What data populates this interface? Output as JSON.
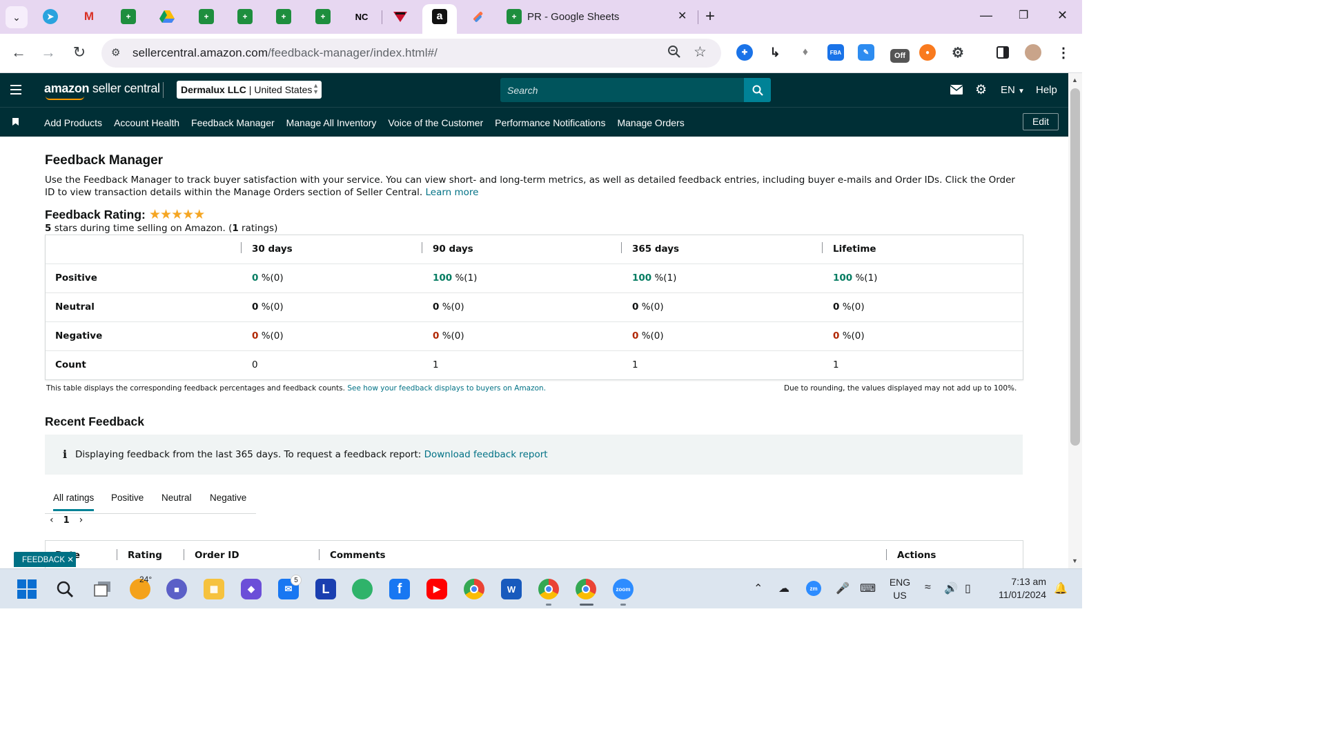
{
  "browser": {
    "active_tab_title": "PR - Google Sheets",
    "favicons": [
      "telegram-icon",
      "gmail-icon",
      "sheets-icon",
      "drive-icon",
      "sheets-icon",
      "sheets-icon",
      "sheets-icon",
      "sheets-icon",
      "nc-icon",
      "ncaa-icon",
      "amazon-icon",
      "tasks-icon"
    ],
    "nc_label": "NC",
    "amazon_label": "a",
    "url_domain": "sellercentral.amazon.com",
    "url_path": "/feedback-manager/index.html#/",
    "ext_fba_label": "FBA",
    "ext_off_label": "Off"
  },
  "header": {
    "logo_amazon": "amazon",
    "logo_rest": " seller central",
    "account_name": "Dermalux LLC",
    "account_region": "United States",
    "account_sep": " | ",
    "search_placeholder": "Search",
    "language": "EN",
    "help": "Help"
  },
  "nav": {
    "links": [
      "Add Products",
      "Account Health",
      "Feedback Manager",
      "Manage All Inventory",
      "Voice of the Customer",
      "Performance Notifications",
      "Manage Orders"
    ],
    "edit": "Edit"
  },
  "page": {
    "title": "Feedback Manager",
    "description": "Use the Feedback Manager to track buyer satisfaction with your service. You can view short- and long-term metrics, as well as detailed feedback entries, including buyer e-mails and Order IDs. Click the Order ID to view transaction details within the Manage Orders section of Seller Central.",
    "learn_more": "Learn more",
    "rating_heading": "Feedback Rating:",
    "stars": 5,
    "rating_prefix": "5",
    "rating_mid": " stars during time selling on Amazon. (",
    "rating_count": "1",
    "rating_suffix": " ratings)"
  },
  "feedback_table": {
    "columns": [
      "30 days",
      "90 days",
      "365 days",
      "Lifetime"
    ],
    "rows": [
      {
        "label": "Positive",
        "values": [
          [
            "0",
            " %(0)"
          ],
          [
            "100",
            " %(1)"
          ],
          [
            "100",
            " %(1)"
          ],
          [
            "100",
            " %(1)"
          ]
        ]
      },
      {
        "label": "Neutral",
        "values": [
          [
            "0",
            " %(0)"
          ],
          [
            "0",
            " %(0)"
          ],
          [
            "0",
            " %(0)"
          ],
          [
            "0",
            " %(0)"
          ]
        ]
      },
      {
        "label": "Negative",
        "values": [
          [
            "0",
            " %(0)"
          ],
          [
            "0",
            " %(0)"
          ],
          [
            "0",
            " %(0)"
          ],
          [
            "0",
            " %(0)"
          ]
        ]
      },
      {
        "label": "Count",
        "values": [
          [
            "0",
            ""
          ],
          [
            "1",
            ""
          ],
          [
            "1",
            ""
          ],
          [
            "1",
            ""
          ]
        ]
      }
    ],
    "note_left": "This table displays the corresponding feedback percentages and feedback counts.",
    "note_left_link": "See how your feedback displays to buyers on Amazon.",
    "note_right": "Due to rounding, the values displayed may not add up to 100%."
  },
  "recent": {
    "title": "Recent Feedback",
    "info_text": "Displaying feedback from the last 365 days. To request a feedback report:",
    "info_link": "Download feedback report",
    "tabs": [
      "All ratings",
      "Positive",
      "Neutral",
      "Negative"
    ],
    "page": "1",
    "columns": [
      "Date",
      "Rating",
      "Order ID",
      "Comments",
      "Actions"
    ],
    "feedback_tag": "FEEDBACK"
  },
  "taskbar": {
    "weather": "24°",
    "mail_badge": "5",
    "l_label": "L",
    "word_label": "W",
    "zoom_label": "zoom",
    "zm_label": "zm",
    "lang_top": "ENG",
    "lang_bottom": "US",
    "time": "7:13 am",
    "date": "11/01/2024"
  }
}
